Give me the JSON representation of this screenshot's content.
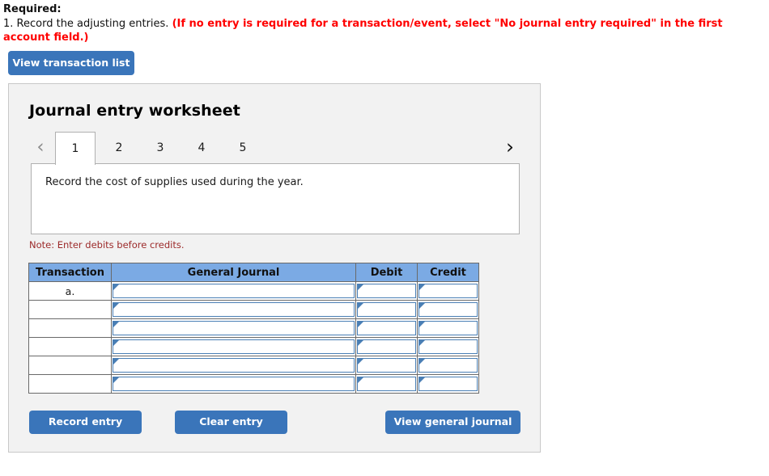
{
  "instructions": {
    "required_label": "Required:",
    "item_number": "1.",
    "item_text": "Record the adjusting entries.",
    "red_note": "(If no entry is required for a transaction/event, select \"No journal entry required\" in the first account field.)"
  },
  "toolbar": {
    "view_transaction_list": "View transaction list"
  },
  "worksheet": {
    "title": "Journal entry worksheet",
    "prev_chevron": "‹",
    "next_chevron": "›",
    "tabs": [
      {
        "label": "1",
        "active": true
      },
      {
        "label": "2",
        "active": false
      },
      {
        "label": "3",
        "active": false
      },
      {
        "label": "4",
        "active": false
      },
      {
        "label": "5",
        "active": false
      }
    ],
    "prompt": "Record the cost of supplies used during the year.",
    "note": "Note: Enter debits before credits."
  },
  "table": {
    "headers": [
      "Transaction",
      "General Journal",
      "Debit",
      "Credit"
    ],
    "rows": [
      {
        "transaction": "a.",
        "general_journal": "",
        "debit": "",
        "credit": ""
      },
      {
        "transaction": "",
        "general_journal": "",
        "debit": "",
        "credit": ""
      },
      {
        "transaction": "",
        "general_journal": "",
        "debit": "",
        "credit": ""
      },
      {
        "transaction": "",
        "general_journal": "",
        "debit": "",
        "credit": ""
      },
      {
        "transaction": "",
        "general_journal": "",
        "debit": "",
        "credit": ""
      },
      {
        "transaction": "",
        "general_journal": "",
        "debit": "",
        "credit": ""
      }
    ]
  },
  "footer": {
    "record_entry": "Record entry",
    "clear_entry": "Clear entry",
    "view_general_journal": "View general journal"
  },
  "colors": {
    "button_blue": "#3a75ba",
    "header_blue": "#7baae4",
    "note_red": "#9c2a2a",
    "alert_red": "#ff0000",
    "panel_gray": "#f2f2f2",
    "field_border_blue": "#4a7fb5"
  }
}
